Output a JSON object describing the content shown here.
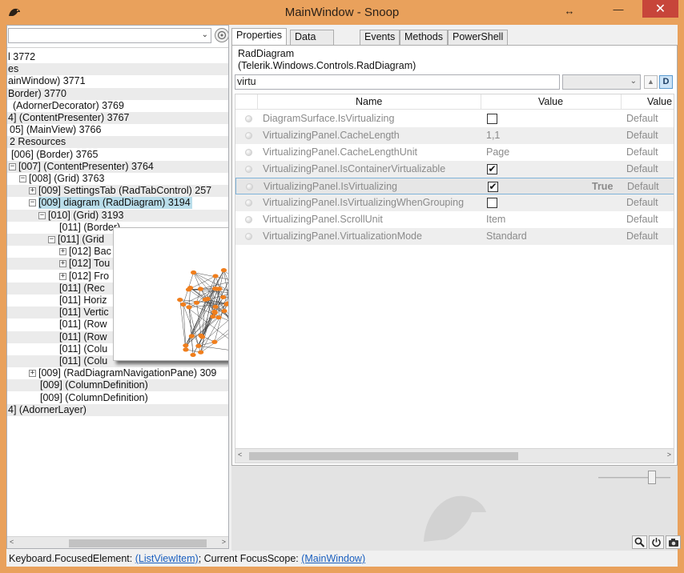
{
  "window": {
    "title": "MainWindow - Snoop",
    "restore_glyph": "↔",
    "minimize_glyph": "—",
    "maximize_glyph": "□",
    "close_glyph": "✕"
  },
  "left": {
    "combo_arrow": "⌄",
    "hscroll_left": "<",
    "hscroll_right": ">",
    "tree": [
      {
        "text": "l 3772",
        "indent": 0,
        "exp": "",
        "alt": false,
        "sel": false
      },
      {
        "text": "es",
        "indent": 0,
        "exp": "",
        "alt": true,
        "sel": false
      },
      {
        "text": "ainWindow) 3771",
        "indent": 0,
        "exp": "",
        "alt": false,
        "sel": false
      },
      {
        "text": "Border) 3770",
        "indent": 0,
        "exp": "",
        "alt": true,
        "sel": false
      },
      {
        "text": "(AdornerDecorator) 3769",
        "indent": 6,
        "exp": "",
        "alt": false,
        "sel": false
      },
      {
        "text": "4]  (ContentPresenter) 3767",
        "indent": 0,
        "exp": "",
        "alt": true,
        "sel": false
      },
      {
        "text": "05]  (MainView) 3766",
        "indent": 2,
        "exp": "",
        "alt": false,
        "sel": false
      },
      {
        "text": "2 Resources",
        "indent": 2,
        "exp": "",
        "alt": true,
        "sel": false
      },
      {
        "text": "[006]  (Border) 3765",
        "indent": 4,
        "exp": "",
        "alt": false,
        "sel": false
      },
      {
        "text": "[007]  (ContentPresenter) 3764",
        "indent": 13,
        "exp": "−",
        "alt": true,
        "sel": false
      },
      {
        "text": "[008]  (Grid) 3763",
        "indent": 26,
        "exp": "−",
        "alt": false,
        "sel": false
      },
      {
        "text": "[009]  SettingsTab (RadTabControl) 257",
        "indent": 38,
        "exp": "+",
        "alt": true,
        "sel": false
      },
      {
        "text": "[009] diagram (RadDiagram) 3194",
        "indent": 38,
        "exp": "−",
        "alt": false,
        "sel": true
      },
      {
        "text": "[010]  (Grid) 3193",
        "indent": 50,
        "exp": "−",
        "alt": true,
        "sel": false
      },
      {
        "text": "[011]  (Border)",
        "indent": 64,
        "exp": "",
        "alt": false,
        "sel": false
      },
      {
        "text": "[011]  (Grid",
        "indent": 62,
        "exp": "−",
        "alt": true,
        "sel": false
      },
      {
        "text": "[012] Bac",
        "indent": 76,
        "exp": "+",
        "alt": false,
        "sel": false
      },
      {
        "text": "[012] Tou",
        "indent": 76,
        "exp": "+",
        "alt": true,
        "sel": false
      },
      {
        "text": "[012] Fro",
        "indent": 76,
        "exp": "+",
        "alt": false,
        "sel": false
      },
      {
        "text": "[011]  (Rec",
        "indent": 64,
        "exp": "",
        "alt": true,
        "sel": false
      },
      {
        "text": "[011]  Horiz",
        "indent": 64,
        "exp": "",
        "alt": false,
        "sel": false
      },
      {
        "text": "[011]  Vertic",
        "indent": 64,
        "exp": "",
        "alt": true,
        "sel": false
      },
      {
        "text": "[011]  (Row",
        "indent": 64,
        "exp": "",
        "alt": false,
        "sel": false
      },
      {
        "text": "[011]  (Row",
        "indent": 64,
        "exp": "",
        "alt": true,
        "sel": false
      },
      {
        "text": "[011]  (Colu",
        "indent": 64,
        "exp": "",
        "alt": false,
        "sel": false
      },
      {
        "text": "[011]  (Colu",
        "indent": 64,
        "exp": "",
        "alt": true,
        "sel": false
      },
      {
        "text": "[009]  (RadDiagramNavigationPane) 309",
        "indent": 38,
        "exp": "+",
        "alt": false,
        "sel": false
      },
      {
        "text": "[009]  (ColumnDefinition)",
        "indent": 40,
        "exp": "",
        "alt": true,
        "sel": false
      },
      {
        "text": "[009]  (ColumnDefinition)",
        "indent": 40,
        "exp": "",
        "alt": false,
        "sel": false
      },
      {
        "text": "4]  (AdornerLayer)",
        "indent": 0,
        "exp": "",
        "alt": true,
        "sel": false
      }
    ]
  },
  "tabs": [
    "Properties",
    "Data Context",
    "Events",
    "Methods",
    "PowerShell"
  ],
  "props": {
    "object_name_line1": "RadDiagram",
    "object_name_line2": "(Telerik.Windows.Controls.RadDiagram)",
    "filter_value": "virtu",
    "combo_arrow": "⌄",
    "up_glyph": "▲",
    "d_label": "D",
    "hscroll_left": "<",
    "hscroll_right": ">",
    "headers": {
      "name": "Name",
      "value": "Value",
      "value_source": "Value"
    },
    "rows": [
      {
        "name": "DiagramSurface.IsVirtualizing",
        "kind": "check",
        "checked": false,
        "value": "",
        "source": "Default",
        "extra": ""
      },
      {
        "name": "VirtualizingPanel.CacheLength",
        "kind": "text",
        "checked": false,
        "value": "1,1",
        "source": "Default",
        "extra": ""
      },
      {
        "name": "VirtualizingPanel.CacheLengthUnit",
        "kind": "text",
        "checked": false,
        "value": "Page",
        "source": "Default",
        "extra": ""
      },
      {
        "name": "VirtualizingPanel.IsContainerVirtualizable",
        "kind": "check",
        "checked": true,
        "value": "",
        "source": "Default",
        "extra": ""
      },
      {
        "name": "VirtualizingPanel.IsVirtualizing",
        "kind": "check",
        "checked": true,
        "value": "",
        "source": "Default",
        "extra": "True"
      },
      {
        "name": "VirtualizingPanel.IsVirtualizingWhenGrouping",
        "kind": "check",
        "checked": false,
        "value": "",
        "source": "Default",
        "extra": ""
      },
      {
        "name": "VirtualizingPanel.ScrollUnit",
        "kind": "text",
        "checked": false,
        "value": "Item",
        "source": "Default",
        "extra": ""
      },
      {
        "name": "VirtualizingPanel.VirtualizationMode",
        "kind": "text",
        "checked": false,
        "value": "Standard",
        "source": "Default",
        "extra": ""
      }
    ],
    "selected_row": 4
  },
  "status": {
    "prefix": "Keyboard.FocusedElement: ",
    "focused_link": "(ListViewItem)",
    "middle": "; Current FocusScope: ",
    "scope_link": "(MainWindow)"
  },
  "colors": {
    "frame": "#e9a15c",
    "close": "#c7453a",
    "selection": "#b9ddea",
    "node": "#f07e1c",
    "link": "#1a5fbf"
  }
}
